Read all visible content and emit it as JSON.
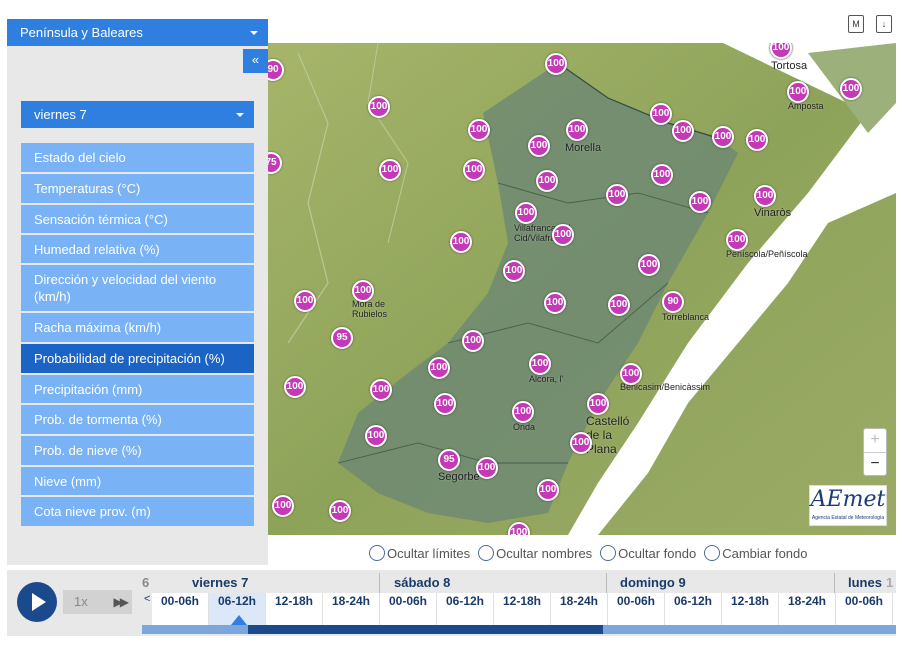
{
  "panel": {
    "region": "Península y Baleares",
    "collapse": "«",
    "day": "viernes 7",
    "menu": [
      "Estado del cielo",
      "Temperaturas (°C)",
      "Sensación térmica (°C)",
      "Humedad relativa (%)",
      "Dirección y velocidad del viento (km/h)",
      "Racha máxima (km/h)",
      "Probabilidad de precipitación (%)",
      "Precipitación (mm)",
      "Prob. de tormenta (%)",
      "Prob. de nieve (%)",
      "Nieve (mm)",
      "Cota nieve prov. (m)"
    ],
    "active_item": "Probabilidad de precipitación (%)"
  },
  "top_icons": {
    "m": "M",
    "download": "↓"
  },
  "map": {
    "places": [
      "Tortosa",
      "Amposta",
      "Morella",
      "Vinaròs",
      "Villafranca del Cid/Vilafranca",
      "Peníscola/Peñíscola",
      "Mora de Rubielos",
      "Torreblanca",
      "Alcora, l'",
      "Benicasim/Benicàssim",
      "Onda",
      "Castelló de la Plana",
      "Segorbe"
    ],
    "values": [
      90,
      75,
      100,
      100,
      100,
      100,
      100,
      100,
      100,
      100,
      100,
      100,
      100,
      100,
      100,
      100,
      100,
      100,
      100,
      100,
      100,
      100,
      100,
      100,
      100,
      100,
      100,
      100,
      100,
      100,
      100,
      90,
      95,
      100,
      100,
      100,
      100,
      100,
      100,
      100,
      100,
      100,
      100,
      100,
      95,
      100,
      100,
      100,
      100,
      100,
      100,
      100,
      100,
      100,
      100
    ],
    "colors": {
      "marker": "#c439b6",
      "relief": "#8ea35a",
      "province": "#6f8a72"
    }
  },
  "map_toggles": [
    "Ocultar límites",
    "Ocultar nombres",
    "Ocultar fondo",
    "Cambiar fondo"
  ],
  "zoom": {
    "in": "+",
    "out": "−"
  },
  "logo": {
    "brand": "AEmet",
    "sub": "Agencia Estatal de Meteorología"
  },
  "timeline": {
    "speed": "1x",
    "ff": "▶▶",
    "prev_day_fragment": "6",
    "next_day_fragment": "1",
    "days": [
      "viernes 7",
      "sábado 8",
      "domingo 9",
      "lunes"
    ],
    "hours": [
      "00-06h",
      "06-12h",
      "12-18h",
      "18-24h",
      "00-06h",
      "06-12h",
      "12-18h",
      "18-24h",
      "00-06h",
      "06-12h",
      "12-18h",
      "18-24h",
      "00-06h"
    ],
    "selected_hour_index": 1,
    "left_arrow": "<",
    "right_arrow": ">"
  }
}
